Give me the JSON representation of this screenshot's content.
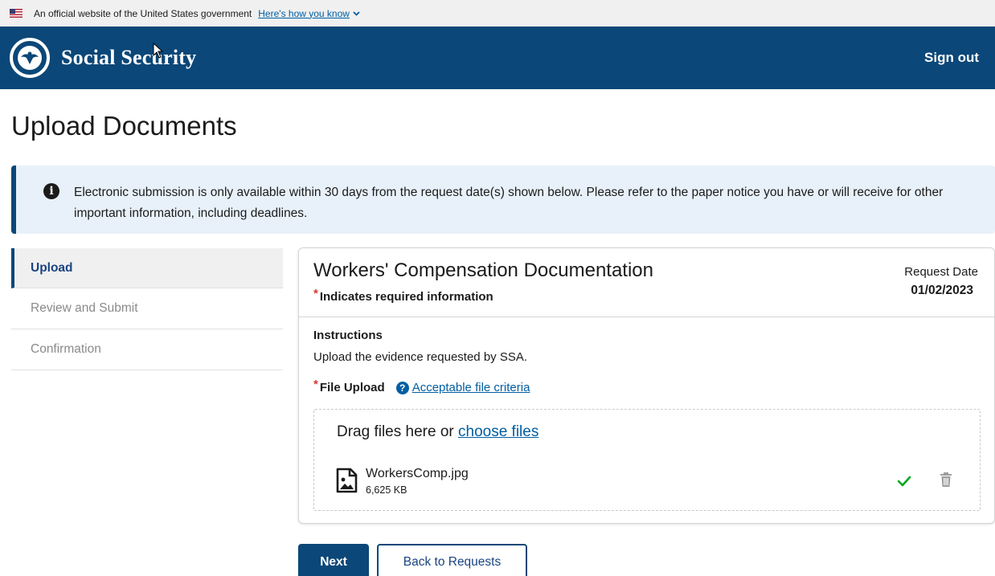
{
  "gov_banner": {
    "text": "An official website of the United States government",
    "how_link": "Here's how you know"
  },
  "header": {
    "brand": "Social Security",
    "sign_out": "Sign out"
  },
  "page": {
    "title": "Upload Documents"
  },
  "alert": {
    "text": "Electronic submission is only available within 30 days from the request date(s) shown below. Please refer to the paper notice you have or will receive for other important information, including deadlines."
  },
  "sidenav": {
    "items": [
      {
        "label": "Upload",
        "active": true
      },
      {
        "label": "Review and Submit",
        "active": false
      },
      {
        "label": "Confirmation",
        "active": false
      }
    ]
  },
  "card": {
    "title": "Workers' Compensation Documentation",
    "required_asterisk": "*",
    "required_note": "Indicates required information",
    "request_date_label": "Request Date",
    "request_date_value": "01/02/2023",
    "instructions_label": "Instructions",
    "instructions_text": "Upload the evidence requested by SSA.",
    "file_upload_label": "File Upload",
    "criteria_link": "Acceptable file criteria",
    "dropzone_prefix": "Drag files here or",
    "dropzone_link": "choose files",
    "file": {
      "name": "WorkersComp.jpg",
      "size": "6,625 KB"
    }
  },
  "buttons": {
    "next": "Next",
    "back": "Back to Requests"
  },
  "colors": {
    "header_bg": "#0b4778",
    "link": "#005ea2",
    "alert_bg": "#e8f1f9",
    "required": "#d83933",
    "success": "#00a91c"
  }
}
